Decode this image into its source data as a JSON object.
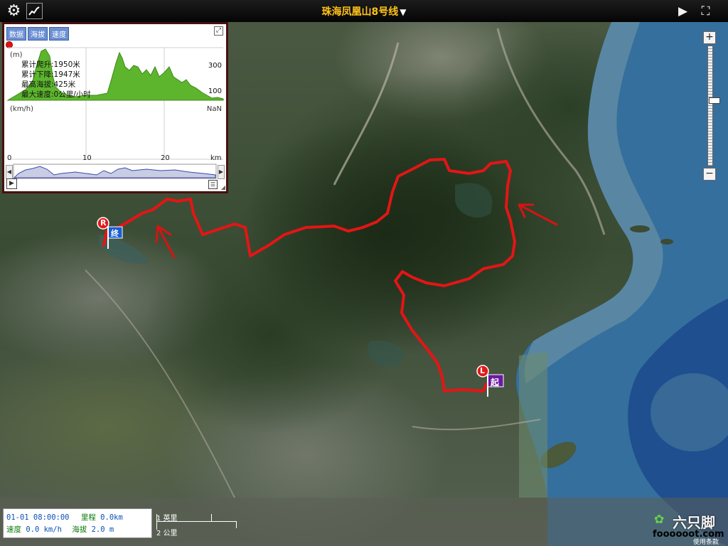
{
  "topbar": {
    "route_title": "珠海凤凰山8号线",
    "title_arrow": "▼",
    "settings_icon": "gear-icon",
    "stats_icon": "chart-line-icon",
    "play_icon": "play-icon",
    "fullscreen_icon": "fullscreen-icon"
  },
  "panel": {
    "tabs": [
      {
        "label": "数据"
      },
      {
        "label": "海拔"
      },
      {
        "label": "速度"
      }
    ],
    "elev_unit": "(m)",
    "elev_tick_top": "300",
    "elev_tick_bottom": "100",
    "stats": [
      "累计爬升:1950米",
      "累计下降:1947米",
      "最高海拔:425米",
      "最大速度:0公里/小时"
    ],
    "speed_unit": "(km/h)",
    "speed_value": "NaN",
    "distance_ticks": [
      "0",
      "10",
      "20"
    ],
    "distance_unit": "km"
  },
  "map": {
    "start_letter": "L",
    "start_flag": "起",
    "end_letter": "R",
    "end_flag": "终",
    "route_color": "#e41515"
  },
  "status": {
    "datetime": "01-01 08:00:00",
    "mileage_label": "里程",
    "mileage_value": "0.0km",
    "speed_label": "速度",
    "speed_value": "0.0 km/h",
    "altitude_label": "海拔",
    "altitude_value": "2.0 m"
  },
  "scale": {
    "miles": "1 英里",
    "km": "2 公里"
  },
  "branding": {
    "logo_name": "六只脚",
    "logo_url": "foooooot.com",
    "terms": "使用条款"
  },
  "colors": {
    "title": "#ffc21a",
    "elevation_fill": "#5db52d",
    "panel_border": "#4a0f0f"
  }
}
